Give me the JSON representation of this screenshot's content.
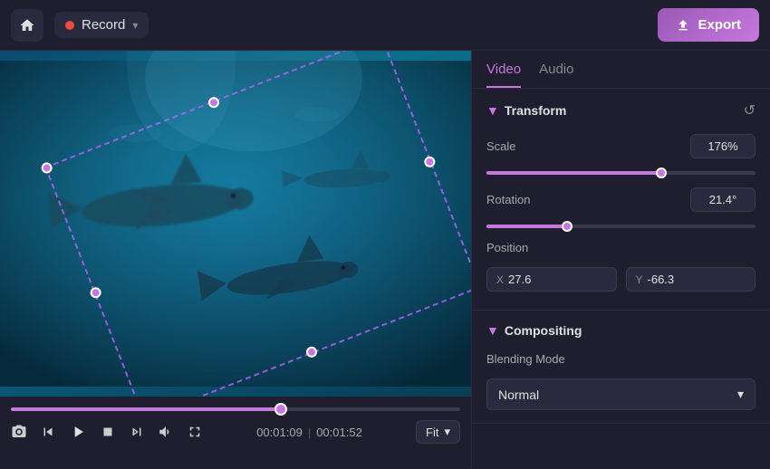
{
  "topbar": {
    "home_icon": "⌂",
    "record_label": "Record",
    "record_chevron": "▾",
    "export_icon": "⬆",
    "export_label": "Export"
  },
  "controls": {
    "screenshot_icon": "📷",
    "rewind_icon": "◀",
    "play_icon": "▶",
    "stop_icon": "■",
    "skip_icon": "▶",
    "volume_icon": "🔊",
    "fullscreen_icon": "⛶",
    "current_time": "00:01:09",
    "total_time": "00:01:52",
    "fit_label": "Fit",
    "fit_chevron": "▾"
  },
  "panel": {
    "tab_video": "Video",
    "tab_audio": "Audio",
    "transform_title": "Transform",
    "reset_icon": "↺",
    "scale_label": "Scale",
    "scale_value": "176%",
    "rotation_label": "Rotation",
    "rotation_value": "21.4°",
    "position_label": "Position",
    "position_x_label": "X",
    "position_x_value": "27.6",
    "position_y_label": "Y",
    "position_y_value": "-66.3",
    "compositing_title": "Compositing",
    "blending_mode_label": "Blending Mode",
    "blending_mode_value": "Normal",
    "blending_chevron": "▾"
  }
}
